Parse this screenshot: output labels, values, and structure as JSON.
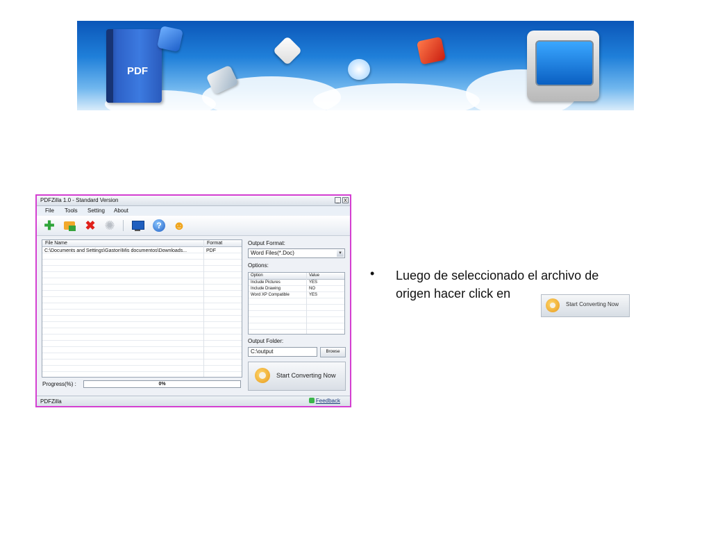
{
  "banner": {
    "book_label": "PDF",
    "icons": [
      "pdf-book-icon",
      "word-icon",
      "stack-icon",
      "diamond-icon",
      "internet-explorer-icon",
      "flash-icon",
      "monitor-icon"
    ]
  },
  "window": {
    "title": "PDFZilla 1.0 - Standard Version",
    "minimize": "_",
    "close": "X",
    "menu": [
      "File",
      "Tools",
      "Setting",
      "About"
    ],
    "toolbar_icons": [
      "add-icon",
      "open-icon",
      "delete-icon",
      "settings-icon",
      "monitor-icon",
      "help-icon",
      "user-icon"
    ],
    "file_list": {
      "columns": [
        "File Name",
        "Format"
      ],
      "rows": [
        {
          "name": "C:\\Documents and Settings\\Gaston\\Mis documentos\\Downloads...",
          "format": "PDF"
        }
      ]
    },
    "progress": {
      "label": "Progress(%)  :",
      "value_text": "0%",
      "value": 0
    },
    "output_format": {
      "label": "Output Format:",
      "selected": "Word Files(*.Doc)"
    },
    "options": {
      "label": "Options:",
      "columns": [
        "Option",
        "Value"
      ],
      "rows": [
        {
          "option": "Include Pictures",
          "value": "YES"
        },
        {
          "option": "Include Drawing",
          "value": "NO"
        },
        {
          "option": "Word XP Compatible",
          "value": "YES"
        }
      ]
    },
    "output_folder": {
      "label": "Output Folder:",
      "value": "C:\\output",
      "browse_label": "Browse"
    },
    "start_button": "Start Converting Now",
    "status": {
      "left": "PDFZilla",
      "feedback": "Feedback"
    }
  },
  "slide": {
    "bullet": "•",
    "text": "Luego de seleccionado el archivo de origen  hacer click en",
    "inline_button": "Start Converting Now"
  },
  "colors": {
    "window_border": "#d43fd1",
    "banner_sky": "#1f7fd9"
  }
}
